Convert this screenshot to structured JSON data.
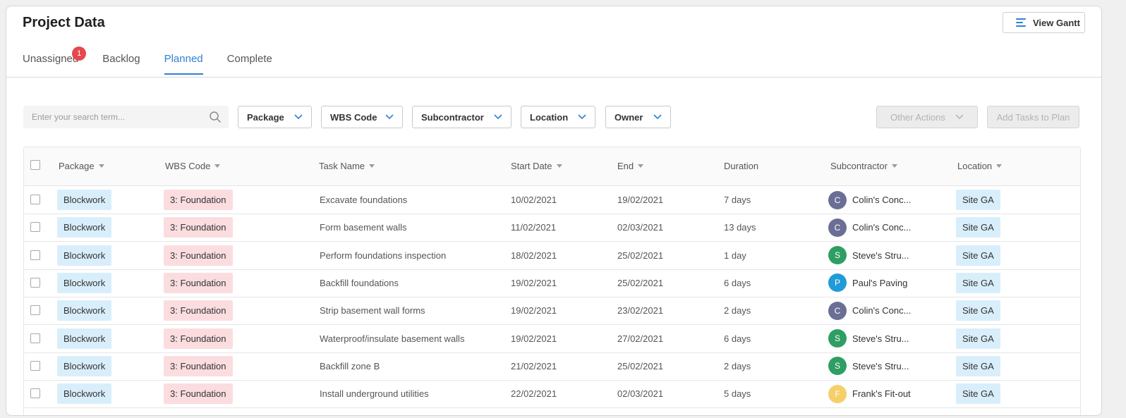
{
  "header": {
    "title": "Project Data",
    "view_gantt_label": "View Gantt"
  },
  "tabs": [
    {
      "label": "Unassigned",
      "badge": "1"
    },
    {
      "label": "Backlog"
    },
    {
      "label": "Planned"
    },
    {
      "label": "Complete"
    }
  ],
  "active_tab": "Planned",
  "search": {
    "placeholder": "Enter your search term...",
    "value": ""
  },
  "filters": [
    "Package",
    "WBS Code",
    "Subcontractor",
    "Location",
    "Owner"
  ],
  "actions": {
    "other_actions": "Other Actions",
    "add_tasks": "Add Tasks to Plan"
  },
  "table": {
    "columns": [
      "Package",
      "WBS Code",
      "Task Name",
      "Start Date",
      "End",
      "Duration",
      "Subcontractor",
      "Location"
    ],
    "rows": [
      {
        "package": "Blockwork",
        "wbs": "3: Foundation",
        "task": "Excavate foundations",
        "start": "10/02/2021",
        "end": "19/02/2021",
        "duration": "7 days",
        "sub_initial": "C",
        "sub_color": "#6b6f95",
        "subcontractor": "Colin's Conc...",
        "location": "Site GA"
      },
      {
        "package": "Blockwork",
        "wbs": "3: Foundation",
        "task": "Form basement walls",
        "start": "11/02/2021",
        "end": "02/03/2021",
        "duration": "13 days",
        "sub_initial": "C",
        "sub_color": "#6b6f95",
        "subcontractor": "Colin's Conc...",
        "location": "Site GA"
      },
      {
        "package": "Blockwork",
        "wbs": "3: Foundation",
        "task": "Perform foundations inspection",
        "start": "18/02/2021",
        "end": "25/02/2021",
        "duration": "1 day",
        "sub_initial": "S",
        "sub_color": "#2f9e63",
        "subcontractor": "Steve's Stru...",
        "location": "Site GA"
      },
      {
        "package": "Blockwork",
        "wbs": "3: Foundation",
        "task": "Backfill foundations",
        "start": "19/02/2021",
        "end": "25/02/2021",
        "duration": "6 days",
        "sub_initial": "P",
        "sub_color": "#1f9bd7",
        "subcontractor": "Paul's Paving",
        "location": "Site GA"
      },
      {
        "package": "Blockwork",
        "wbs": "3: Foundation",
        "task": "Strip basement wall forms",
        "start": "19/02/2021",
        "end": "23/02/2021",
        "duration": "2 days",
        "sub_initial": "C",
        "sub_color": "#6b6f95",
        "subcontractor": "Colin's Conc...",
        "location": "Site GA"
      },
      {
        "package": "Blockwork",
        "wbs": "3: Foundation",
        "task": "Waterproof/insulate basement walls",
        "start": "19/02/2021",
        "end": "27/02/2021",
        "duration": "6 days",
        "sub_initial": "S",
        "sub_color": "#2f9e63",
        "subcontractor": "Steve's Stru...",
        "location": "Site GA"
      },
      {
        "package": "Blockwork",
        "wbs": "3: Foundation",
        "task": "Backfill zone B",
        "start": "21/02/2021",
        "end": "25/02/2021",
        "duration": "2 days",
        "sub_initial": "S",
        "sub_color": "#2f9e63",
        "subcontractor": "Steve's Stru...",
        "location": "Site GA"
      },
      {
        "package": "Blockwork",
        "wbs": "3: Foundation",
        "task": "Install underground utilities",
        "start": "22/02/2021",
        "end": "02/03/2021",
        "duration": "5 days",
        "sub_initial": "F",
        "sub_color": "#f6cf6a",
        "subcontractor": "Frank's Fit-out",
        "location": "Site GA"
      }
    ]
  },
  "colors": {
    "accent": "#2f80d6",
    "badge": "#e5484d",
    "tag_blue": "#d9eefb",
    "tag_red": "#fbdde0"
  }
}
